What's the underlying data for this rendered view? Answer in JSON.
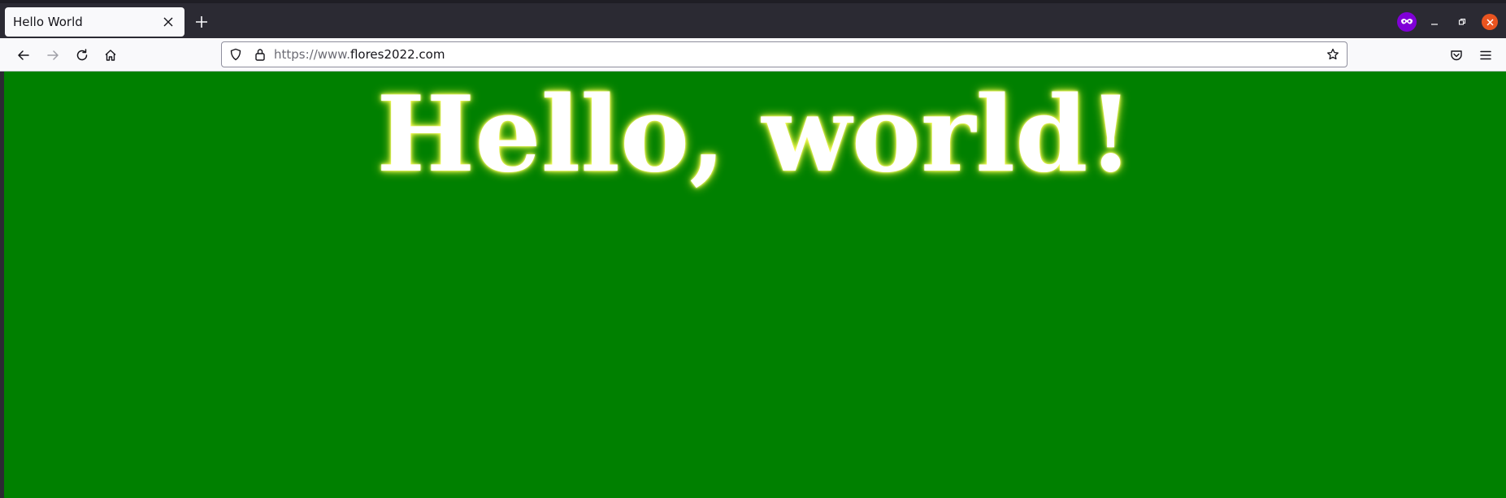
{
  "tab": {
    "title": "Hello World"
  },
  "urlbar": {
    "prefix": "https://www.",
    "domain": "flores2022.com"
  },
  "page": {
    "heading": "Hello, world!",
    "background_color": "#008000"
  },
  "colors": {
    "private_badge": "#8000d7",
    "close_button": "#e95420"
  },
  "icons": [
    "close-icon",
    "plus-icon",
    "private-browsing-icon",
    "minimize-icon",
    "restore-icon",
    "window-close-icon",
    "back-arrow-icon",
    "forward-arrow-icon",
    "reload-icon",
    "home-icon",
    "shield-icon",
    "lock-icon",
    "star-icon",
    "pocket-icon",
    "hamburger-menu-icon"
  ]
}
